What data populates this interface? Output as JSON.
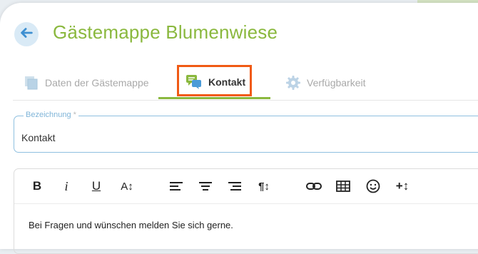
{
  "header": {
    "title": "Gästemappe Blumenwiese",
    "back_icon": "arrow-left-icon"
  },
  "tabs": [
    {
      "label": "Daten der Gästemappe",
      "icon": "pages-icon",
      "active": false
    },
    {
      "label": "Kontakt",
      "icon": "chat-icon",
      "active": true
    },
    {
      "label": "Verfügbarkeit",
      "icon": "gear-icon",
      "active": false
    }
  ],
  "form": {
    "designation": {
      "label": "Bezeichnung",
      "required_mark": "*",
      "value": "Kontakt"
    }
  },
  "editor": {
    "toolbar": {
      "bold": "B",
      "italic": "i",
      "underline": "U",
      "font_size": "A↕",
      "paragraph": "¶↕",
      "insert_more": "+↕"
    },
    "content": "Bei Fragen und wünschen melden Sie sich gerne."
  },
  "colors": {
    "brand_green": "#8ab83e",
    "highlight_orange": "#f05a14",
    "field_border_blue": "#8fc0e0"
  }
}
